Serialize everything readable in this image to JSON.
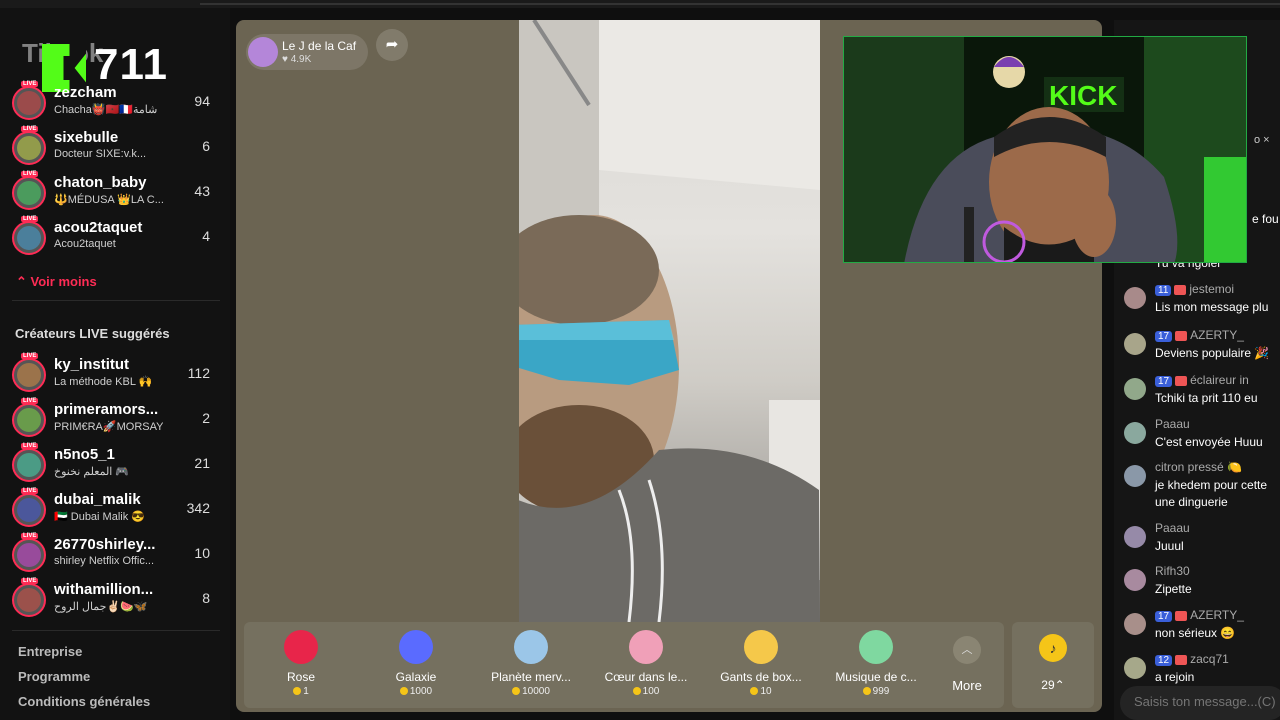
{
  "overlay": {
    "logo_text": "TikTok",
    "kick_count": "711"
  },
  "sidebar": {
    "followed": [
      {
        "name": "zezcham",
        "sub": "Chacha👹🇲🇦🇫🇷شامة",
        "count": "94"
      },
      {
        "name": "sixebulle",
        "sub": "Docteur SIXE:v.k...",
        "count": "6"
      },
      {
        "name": "chaton_baby",
        "sub": "🔱MÉDUSA 👑LA C...",
        "count": "43"
      },
      {
        "name": "acou2taquet",
        "sub": "Acou2taquet",
        "count": "4"
      }
    ],
    "voir_moins": "Voir moins",
    "suggested_title": "Créateurs LIVE suggérés",
    "suggested": [
      {
        "name": "ky_institut",
        "sub": "La méthode KBL 🙌",
        "count": "112"
      },
      {
        "name": "primeramors...",
        "sub": "PRIM€RA🚀MORSAY",
        "count": "2"
      },
      {
        "name": "n5no5_1",
        "sub": "المعلم نخنوخ 🎮",
        "count": "21"
      },
      {
        "name": "dubai_malik",
        "sub": "🇦🇪 Dubai Malik 😎",
        "count": "342"
      },
      {
        "name": "26770shirley...",
        "sub": "shirley Netflix Offic...",
        "count": "10"
      },
      {
        "name": "withamillion...",
        "sub": "جمال الروح✌🏻🍉🦋",
        "count": "8"
      }
    ],
    "footer": [
      "Entreprise",
      "Programme",
      "Conditions générales"
    ]
  },
  "host": {
    "name": "Le J de la Caf",
    "likes": "4.9K",
    "share_icon": "share-arrow-icon"
  },
  "gifts": [
    {
      "label": "Rose",
      "price": "1",
      "color": "#e8254a"
    },
    {
      "label": "Galaxie",
      "price": "1000",
      "color": "#5a6bff"
    },
    {
      "label": "Planète merv...",
      "price": "10000",
      "color": "#9bc6e8"
    },
    {
      "label": "Cœur dans le...",
      "price": "100",
      "color": "#f0a0b8"
    },
    {
      "label": "Gants de box...",
      "price": "10",
      "color": "#f5c84a"
    },
    {
      "label": "Musique de c...",
      "price": "999",
      "color": "#7fd8a0"
    }
  ],
  "more_label": "More",
  "wallet": {
    "count": "29⌃"
  },
  "chat": {
    "partial_lines": [
      "o ×",
      "e fou",
      "Tu va rigoler"
    ],
    "messages": [
      {
        "level": "11",
        "user": "jestemoi",
        "text": "Lis mon message plu"
      },
      {
        "level": "17",
        "user": "AZERTY_",
        "text": "Deviens populaire 🎉"
      },
      {
        "level": "17",
        "user": "éclaireur in",
        "text": "Tchiki ta prit 110 eu"
      },
      {
        "level": "",
        "user": "Paaau",
        "text": "C'est envoyée Huuu"
      },
      {
        "level": "",
        "user": "citron pressé 🍋",
        "text": "je khedem pour cette\nune dinguerie"
      },
      {
        "level": "",
        "user": "Paaau",
        "text": "Juuul"
      },
      {
        "level": "",
        "user": "Rifh30",
        "text": "Zipette"
      },
      {
        "level": "17",
        "user": "AZERTY_",
        "text": "non sérieux 😄"
      },
      {
        "level": "12",
        "user": "zacq71",
        "text": "a rejoin"
      }
    ],
    "input_placeholder": "Saisis ton message...(C)"
  }
}
